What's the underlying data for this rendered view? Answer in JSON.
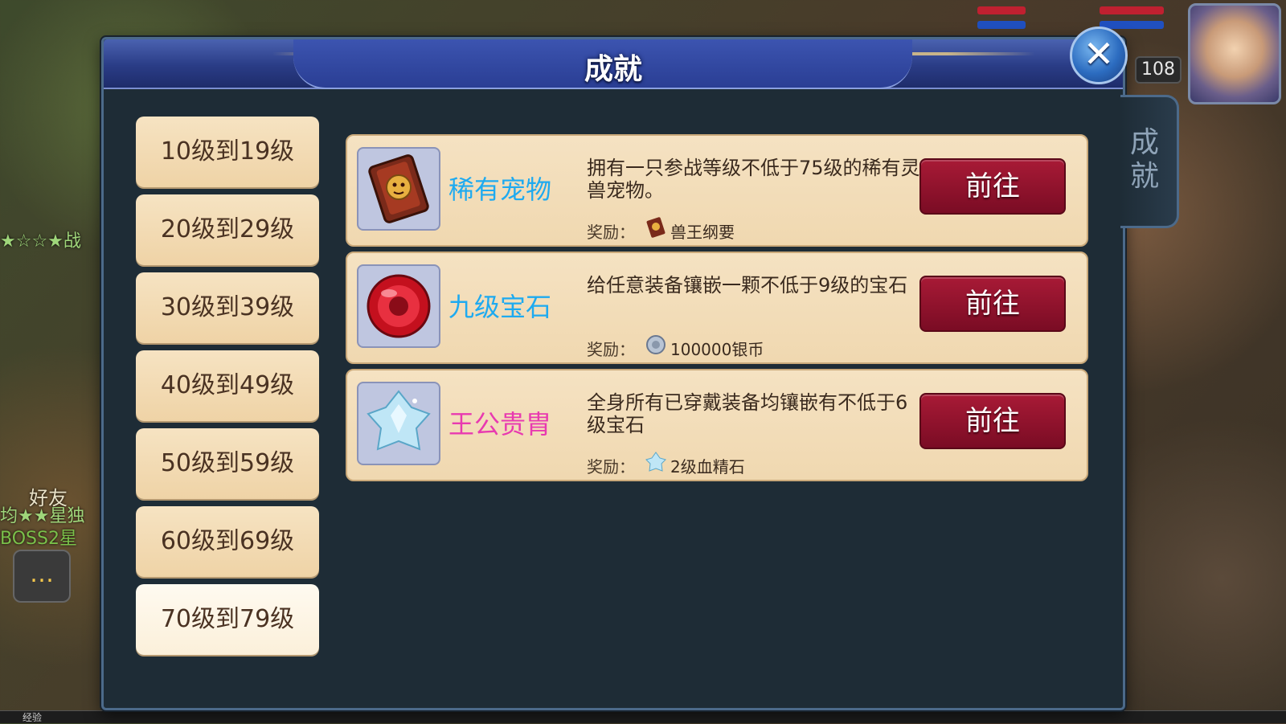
{
  "hud": {
    "level": "108",
    "friend_label": "好友",
    "side_text_1": "★☆☆★战",
    "side_text_2": "均★★星独",
    "side_text_3": "BOSS2星",
    "exp_label": "经验"
  },
  "dialog": {
    "title": "成就",
    "close_label": "✕",
    "side_tab_label": "成就"
  },
  "level_ranges": [
    "10级到19级",
    "20级到29级",
    "30级到39级",
    "40级到49级",
    "50级到59级",
    "60级到69级",
    "70级到79级"
  ],
  "active_range_index": 6,
  "reward_label": "奖励：",
  "achievements": [
    {
      "name": "稀有宠物",
      "name_color": "#1eaaf0",
      "icon": "beast-king-book-icon",
      "description": "拥有一只参战等级不低于75级的稀有灵兽宠物。",
      "reward": "兽王纲要",
      "reward_icon": "book-icon",
      "button": "前往"
    },
    {
      "name": "九级宝石",
      "name_color": "#1eaaf0",
      "icon": "red-gem-icon",
      "description": "给任意装备镶嵌一颗不低于9级的宝石",
      "reward": "100000银币",
      "reward_icon": "silver-coin-icon",
      "button": "前往"
    },
    {
      "name": "王公贵胄",
      "name_color": "#e83ab0",
      "icon": "blood-crystal-icon",
      "description": "全身所有已穿戴装备均镶嵌有不低于6级宝石",
      "reward": "2级血精石",
      "reward_icon": "crystal-icon",
      "button": "前往"
    }
  ]
}
